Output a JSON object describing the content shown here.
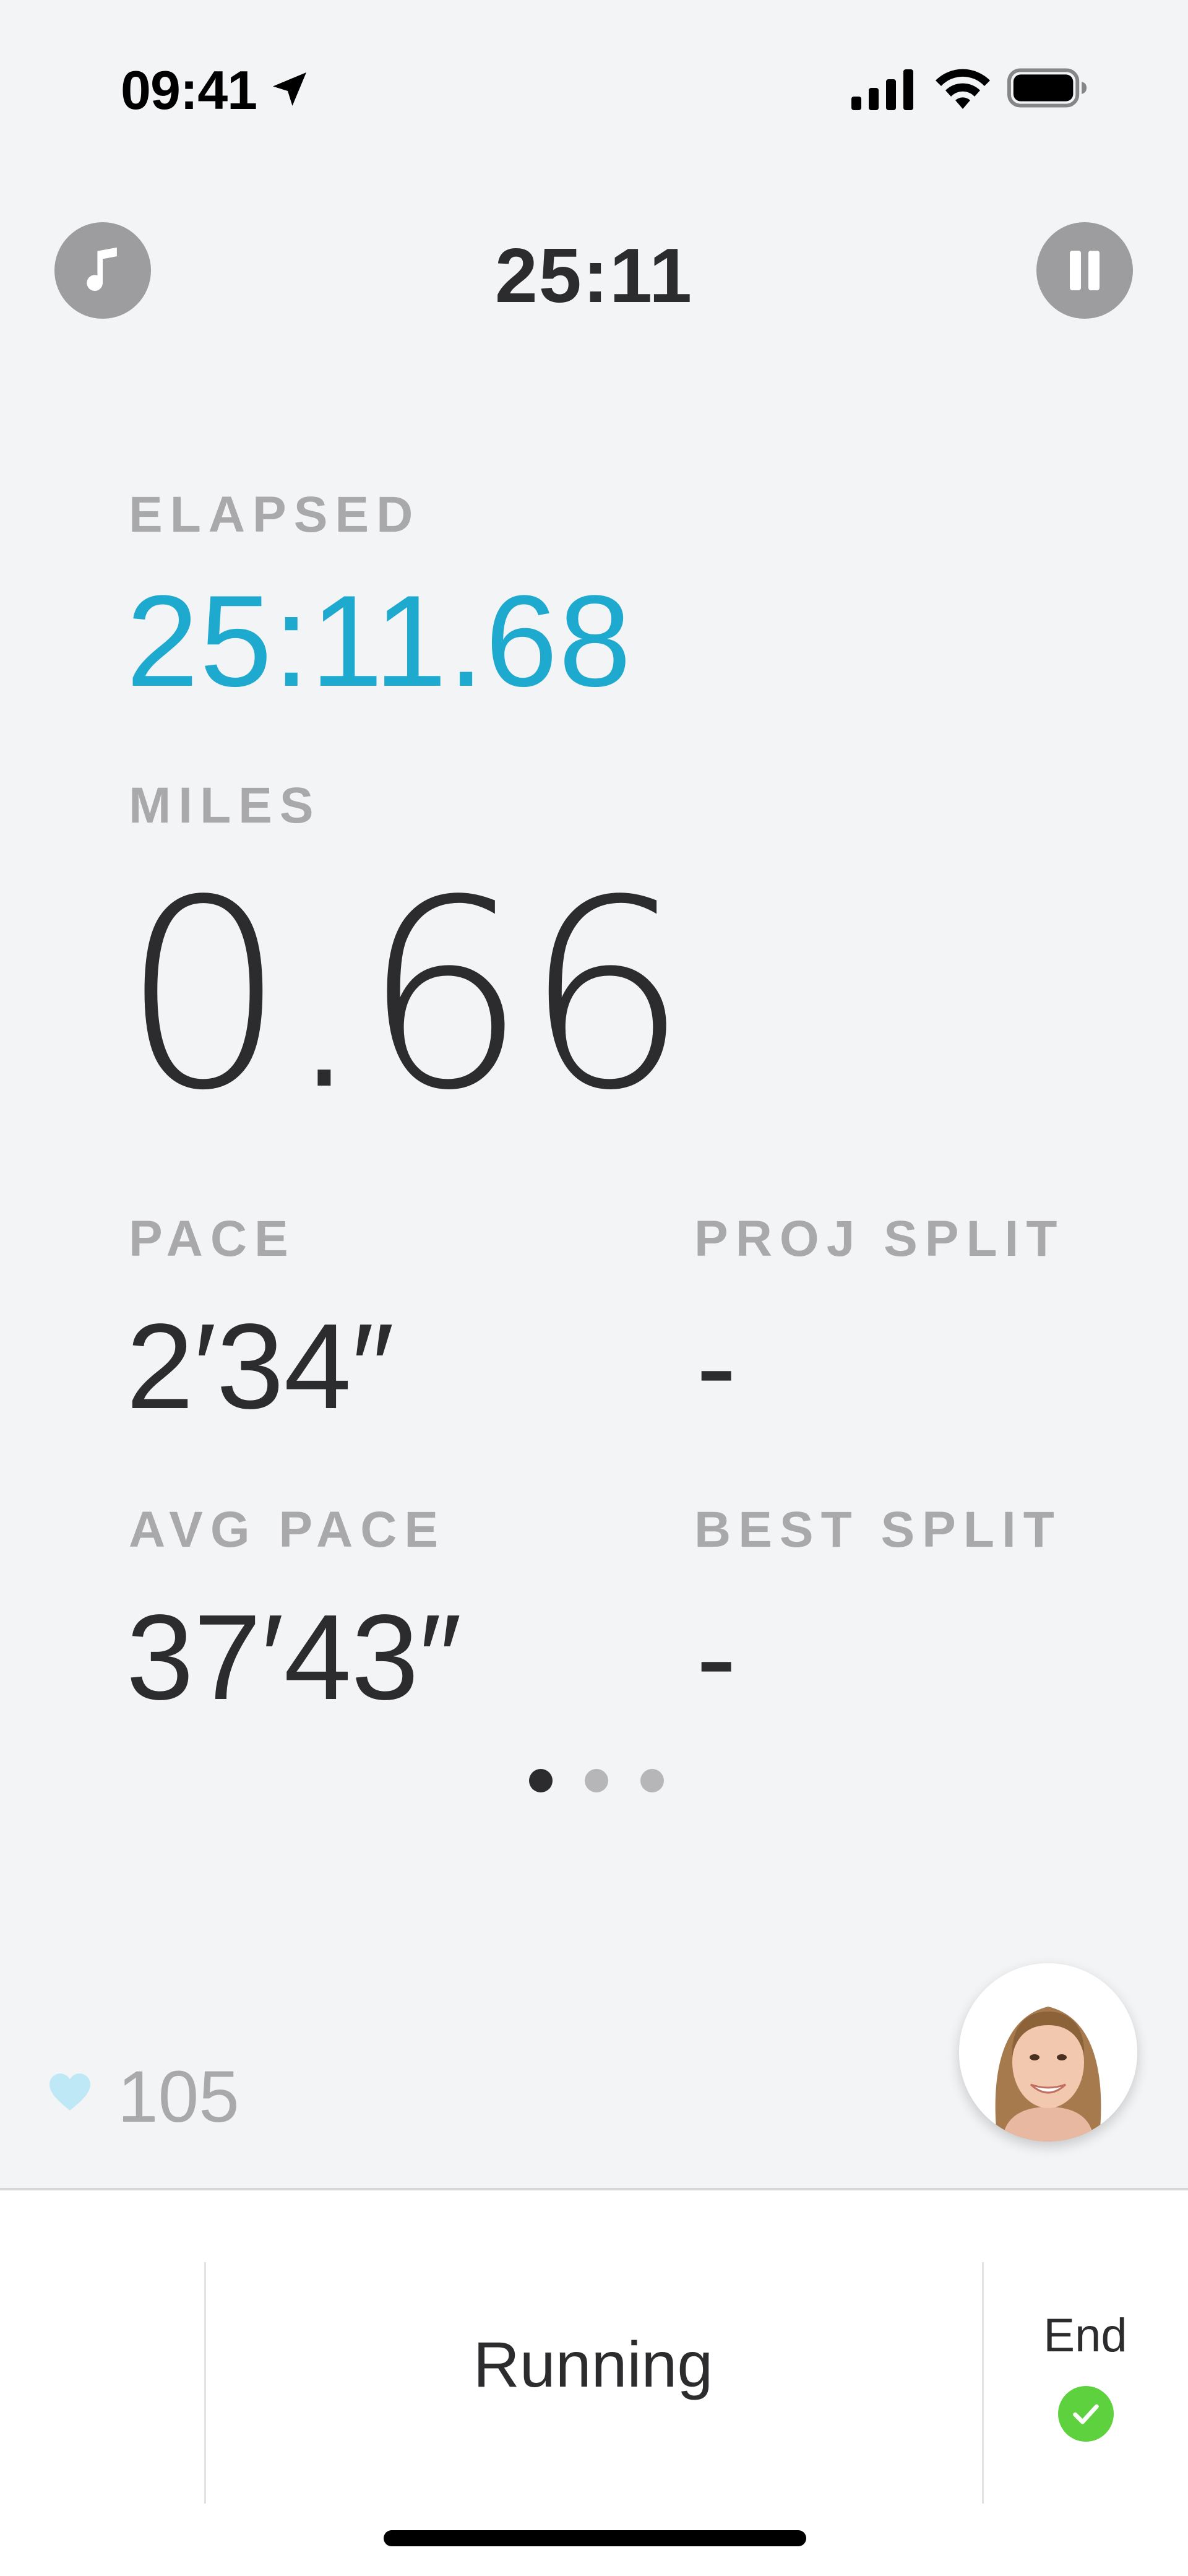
{
  "status_bar": {
    "time": "09:41",
    "icons": [
      "location-arrow-icon",
      "cellular-signal-icon",
      "wifi-icon",
      "battery-icon"
    ]
  },
  "header": {
    "timer": "25:11",
    "music_icon": "music-note-icon",
    "pause_icon": "pause-icon"
  },
  "metrics": {
    "elapsed": {
      "label": "ELAPSED",
      "value": "25:11.68"
    },
    "miles": {
      "label": "MILES",
      "value": "0.66"
    },
    "pace": {
      "label": "PACE",
      "value": "2′34″"
    },
    "proj_split": {
      "label": "PROJ SPLIT",
      "value": "-"
    },
    "avg_pace": {
      "label": "AVG PACE",
      "value": "37′43″"
    },
    "best_split": {
      "label": "BEST SPLIT",
      "value": "-"
    }
  },
  "pager": {
    "total": 3,
    "active_index": 0
  },
  "heart_rate": {
    "value": "105",
    "icon": "heart-icon"
  },
  "coach": {
    "icon": "coach-avatar"
  },
  "bottom_bar": {
    "mode": "Running",
    "end_label": "End",
    "end_icon": "checkmark-icon"
  },
  "colors": {
    "accent": "#1ea9cf",
    "background": "#f3f4f6",
    "end_green": "#5ed23e",
    "heart": "#bfe8f6"
  }
}
